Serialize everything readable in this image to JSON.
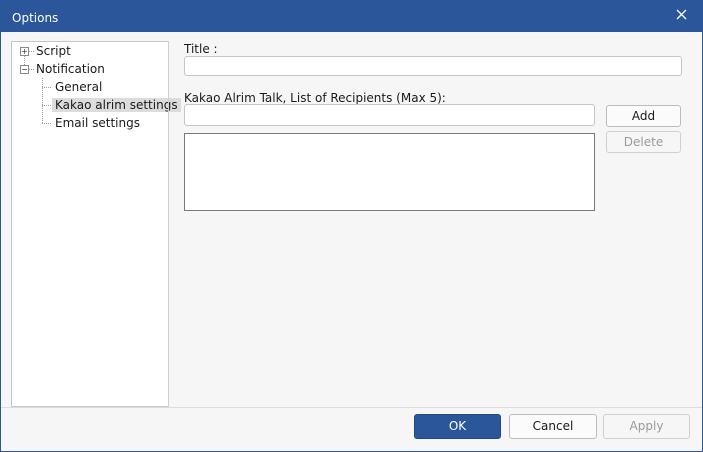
{
  "window": {
    "title": "Options"
  },
  "tree": {
    "items": [
      {
        "label": "Script",
        "expander": "+"
      },
      {
        "label": "Notification",
        "expander": "−"
      },
      {
        "label": "General"
      },
      {
        "label": "Kakao alrim settings",
        "selected": true
      },
      {
        "label": "Email settings"
      }
    ]
  },
  "form": {
    "title_label": "Title :",
    "title_value": "",
    "recipients_label": "Kakao Alrim Talk, List of Recipients (Max 5):",
    "recipient_value": "",
    "add_label": "Add",
    "delete_label": "Delete"
  },
  "footer": {
    "ok_label": "OK",
    "cancel_label": "Cancel",
    "apply_label": "Apply"
  },
  "colors": {
    "accent": "#2b579a"
  }
}
